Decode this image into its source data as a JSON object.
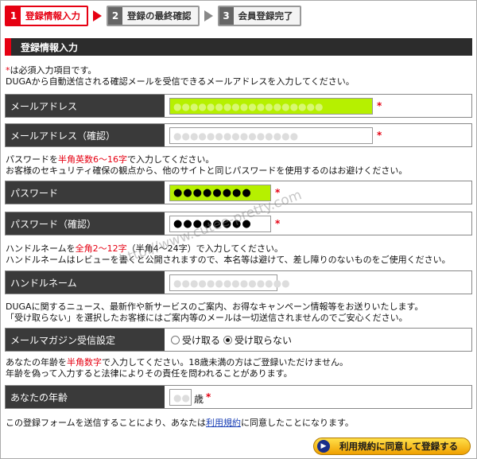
{
  "steps": [
    {
      "num": "1",
      "label": "登録情報入力",
      "active": true
    },
    {
      "num": "2",
      "label": "登録の最終確認",
      "active": false
    },
    {
      "num": "3",
      "label": "会員登録完了",
      "active": false
    }
  ],
  "section_title": "登録情報入力",
  "intro": {
    "required_mark": "*",
    "required_note": "は必須入力項目です。",
    "email_note": "DUGAから自動送信される確認メールを受信できるメールアドレスを入力してください。"
  },
  "email": {
    "label": "メールアドレス",
    "value": "●●●●●●●●●●●●●●●●●●",
    "confirm_label": "メールアドレス（確認）",
    "confirm_value": "●●●●●●●●●●●●●●●",
    "required_mark": "*"
  },
  "password_note": {
    "prefix": "パスワードを",
    "highlight": "半角英数6〜16字",
    "suffix": "で入力してください。",
    "line2": "お客様のセキュリティ確保の観点から、他のサイトと同じパスワードを使用するのはお避けください。"
  },
  "password": {
    "label": "パスワード",
    "value": "●●●●●●●●",
    "confirm_label": "パスワード（確認）",
    "confirm_value": "●●●●●●●●",
    "required_mark": "*"
  },
  "handle_note": {
    "prefix": "ハンドルネームを",
    "highlight": "全角2〜12字",
    "suffix": "（半角4〜24字）で入力してください。",
    "line2": "ハンドルネームはレビューを書くと公開されますので、本名等は避けて、差し障りのないものをご使用ください。"
  },
  "handle": {
    "label": "ハンドルネーム",
    "value": "●●●●●●●●●●●●●●"
  },
  "newsletter_note": {
    "line1": "DUGAに関するニュース、最新作や新サービスのご案内、お得なキャンペーン情報等をお送りいたします。",
    "line2": "「受け取らない」を選択したお客様にはご案内等のメールは一切送信されませんのでご安心ください。"
  },
  "newsletter": {
    "label": "メールマガジン受信設定",
    "opt_yes": "受け取る",
    "opt_no": "受け取らない",
    "selected": "受け取らない"
  },
  "age_note": {
    "prefix": "あなたの年齢を",
    "highlight": "半角数字",
    "suffix": "で入力してください。18歳未満の方はご登録いただけません。",
    "line2": "年齢を偽って入力すると法律によりその責任を問われることがあります。"
  },
  "age": {
    "label": "あなたの年齢",
    "value": "●●",
    "unit": "歳",
    "required_mark": "*"
  },
  "terms": {
    "prefix": "この登録フォームを送信することにより、あなたは",
    "link": "利用規約",
    "suffix": "に同意したことになります。"
  },
  "submit_label": "利用規約に同意して登録する",
  "watermark": "http://www.cutee-pretty.com",
  "colors": {
    "accent": "#e60012",
    "field_highlight": "#b6f000",
    "label_bg": "#3a3a3a",
    "link": "#1a3fb5"
  }
}
